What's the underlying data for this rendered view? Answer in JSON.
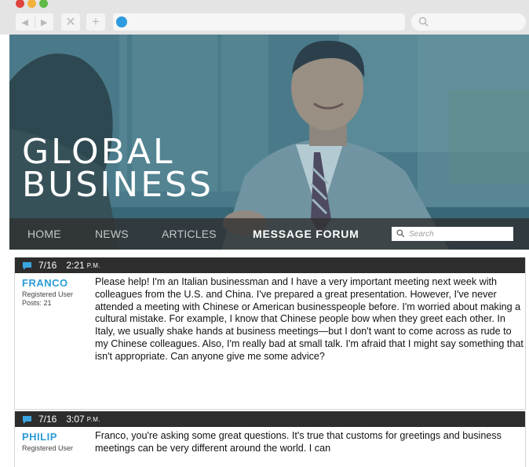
{
  "browser": {
    "address_value": "",
    "search_placeholder": ""
  },
  "site": {
    "title_line1": "GLOBAL",
    "title_line2": "BUSINESS",
    "nav": [
      {
        "label": "HOME"
      },
      {
        "label": "NEWS"
      },
      {
        "label": "ARTICLES"
      },
      {
        "label": "MESSAGE FORUM"
      }
    ],
    "search_placeholder": "Search"
  },
  "posts": [
    {
      "date": "7/16",
      "time": "2:21",
      "ampm": "P.M.",
      "author": "FRANCO",
      "role": "Registered User",
      "posts": "Posts: 21",
      "body": "Please help! I'm an Italian businessman and I have a very important meeting next week with colleagues from the U.S. and China. I've prepared a great presentation. However, I've never attended a meeting with Chinese or American businesspeople before. I'm worried about making a cultural mistake. For example, I know that Chinese people bow when they greet each other. In Italy, we usually shake hands at business meetings—but I don't want to come across as rude to my Chinese colleagues. Also, I'm really bad at small talk. I'm afraid that I might say something that isn't appropriate. Can anyone give me some advice?"
    },
    {
      "date": "7/16",
      "time": "3:07",
      "ampm": "P.M.",
      "author": "PHILIP",
      "role": "Registered User",
      "posts": "",
      "body": "Franco, you're asking some great questions. It's true that customs for greetings and business meetings can be very different around the world. I can"
    }
  ],
  "colors": {
    "accent": "#2a9bd6",
    "post_bar": "#2d2d2d",
    "nav_bar": "#303030"
  }
}
